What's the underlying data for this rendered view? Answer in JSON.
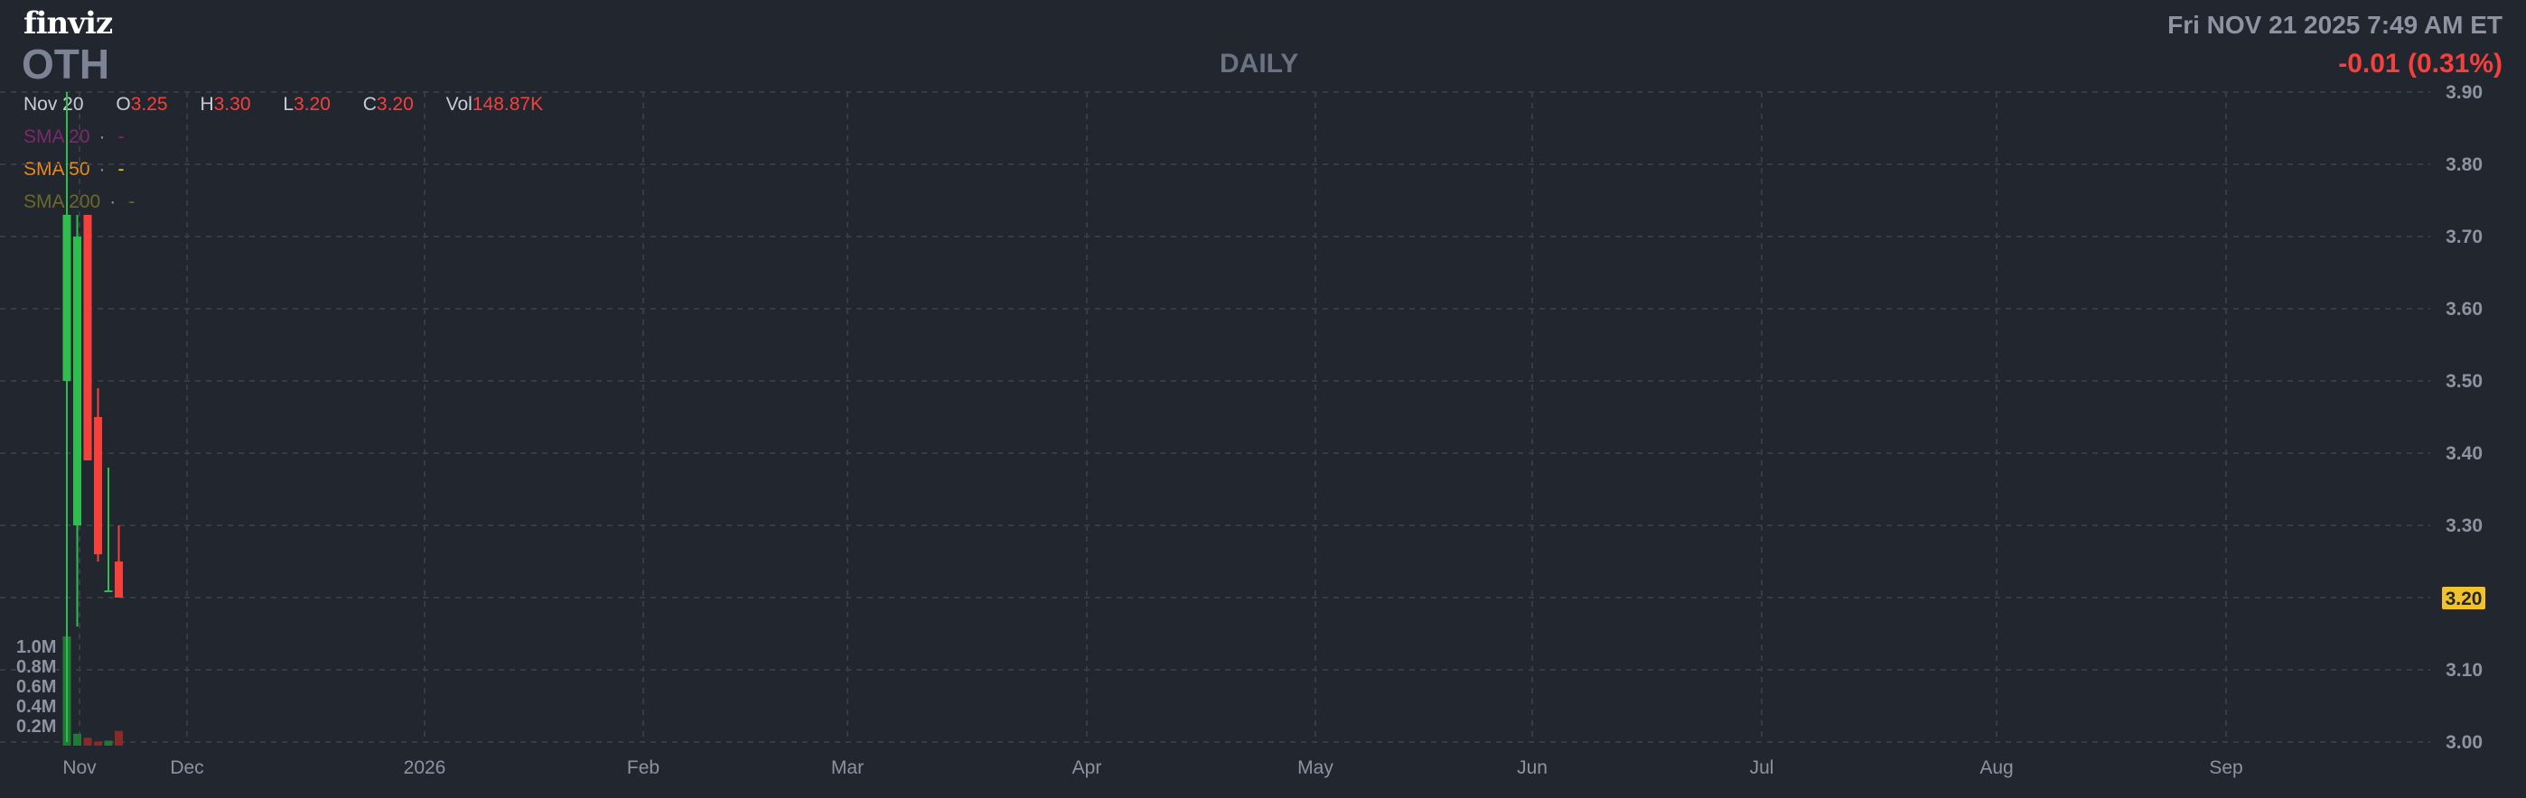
{
  "header": {
    "logo": "finviz",
    "ticker": "OTH",
    "timeframe": "DAILY",
    "datetime": "Fri NOV 21 2025 7:49 AM ET",
    "change": "-0.01 (0.31%)"
  },
  "ohlc": {
    "date": "Nov 20",
    "open_label": "O",
    "open": "3.25",
    "high_label": "H",
    "high": "3.30",
    "low_label": "L",
    "low": "3.20",
    "close_label": "C",
    "close": "3.20",
    "vol_label": "Vol",
    "vol": "148.87K"
  },
  "sma": [
    {
      "label": "SMA 20",
      "dot": "·",
      "value": "-",
      "color": "#7a2a6b"
    },
    {
      "label": "SMA 50",
      "dot": "·",
      "value": "-",
      "color": "#e8891d"
    },
    {
      "label": "SMA 200",
      "dot": "·",
      "value": "-",
      "color": "#6b6a28"
    }
  ],
  "colors": {
    "up": "#2fbd4e",
    "down": "#f5403b",
    "grid": "#363b47",
    "last_price_badge": "#f2c12e"
  },
  "chart_data": {
    "type": "candlestick",
    "y_ticks": [
      "3.00",
      "3.10",
      "3.20",
      "3.30",
      "3.40",
      "3.50",
      "3.60",
      "3.70",
      "3.80",
      "3.90"
    ],
    "ylim": [
      3.0,
      3.9
    ],
    "x_ticks": [
      "Nov",
      "Dec",
      "2026",
      "Feb",
      "Mar",
      "Apr",
      "May",
      "Jun",
      "Jul",
      "Aug",
      "Sep"
    ],
    "last_price": "3.20",
    "volume_ticks": [
      "0.2M",
      "0.4M",
      "0.6M",
      "0.8M",
      "1.0M"
    ],
    "candles": [
      {
        "o": 3.5,
        "h": 3.9,
        "l": 3.0,
        "c": 3.73,
        "vol": 1.1
      },
      {
        "o": 3.3,
        "h": 3.73,
        "l": 3.16,
        "c": 3.7,
        "vol": 0.12
      },
      {
        "o": 3.73,
        "h": 3.73,
        "l": 3.39,
        "c": 3.39,
        "vol": 0.08
      },
      {
        "o": 3.45,
        "h": 3.49,
        "l": 3.25,
        "c": 3.26,
        "vol": 0.04
      },
      {
        "o": 3.21,
        "h": 3.38,
        "l": 3.21,
        "c": 3.21,
        "vol": 0.05
      },
      {
        "o": 3.25,
        "h": 3.3,
        "l": 3.2,
        "c": 3.2,
        "vol": 0.149
      }
    ]
  }
}
